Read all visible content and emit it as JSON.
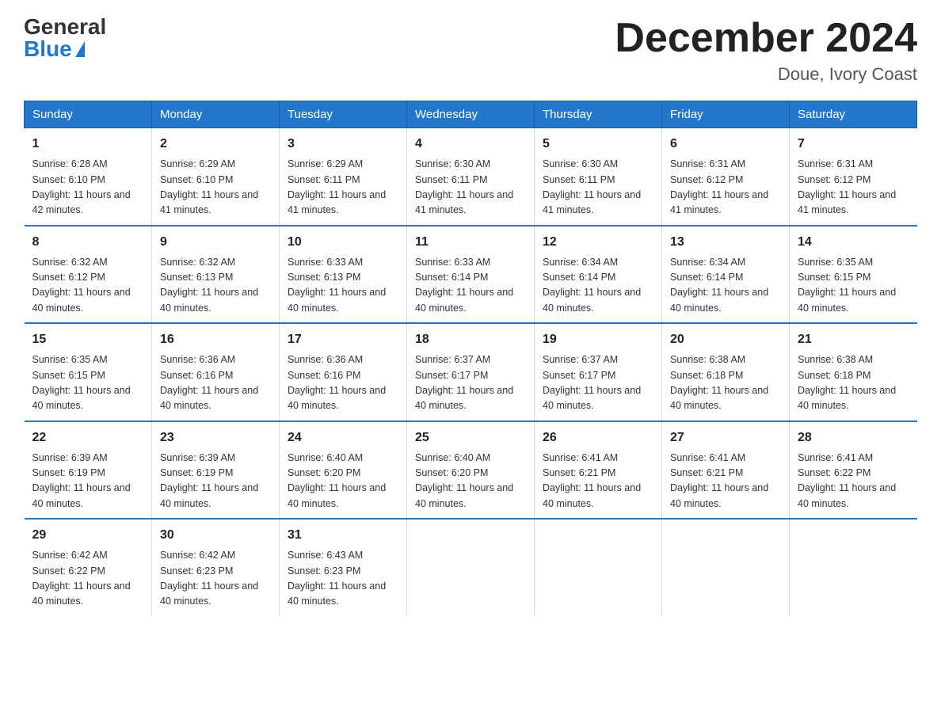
{
  "logo": {
    "general": "General",
    "blue": "Blue"
  },
  "header": {
    "title": "December 2024",
    "subtitle": "Doue, Ivory Coast"
  },
  "columns": [
    "Sunday",
    "Monday",
    "Tuesday",
    "Wednesday",
    "Thursday",
    "Friday",
    "Saturday"
  ],
  "weeks": [
    [
      {
        "day": "1",
        "sunrise": "6:28 AM",
        "sunset": "6:10 PM",
        "daylight": "11 hours and 42 minutes."
      },
      {
        "day": "2",
        "sunrise": "6:29 AM",
        "sunset": "6:10 PM",
        "daylight": "11 hours and 41 minutes."
      },
      {
        "day": "3",
        "sunrise": "6:29 AM",
        "sunset": "6:11 PM",
        "daylight": "11 hours and 41 minutes."
      },
      {
        "day": "4",
        "sunrise": "6:30 AM",
        "sunset": "6:11 PM",
        "daylight": "11 hours and 41 minutes."
      },
      {
        "day": "5",
        "sunrise": "6:30 AM",
        "sunset": "6:11 PM",
        "daylight": "11 hours and 41 minutes."
      },
      {
        "day": "6",
        "sunrise": "6:31 AM",
        "sunset": "6:12 PM",
        "daylight": "11 hours and 41 minutes."
      },
      {
        "day": "7",
        "sunrise": "6:31 AM",
        "sunset": "6:12 PM",
        "daylight": "11 hours and 41 minutes."
      }
    ],
    [
      {
        "day": "8",
        "sunrise": "6:32 AM",
        "sunset": "6:12 PM",
        "daylight": "11 hours and 40 minutes."
      },
      {
        "day": "9",
        "sunrise": "6:32 AM",
        "sunset": "6:13 PM",
        "daylight": "11 hours and 40 minutes."
      },
      {
        "day": "10",
        "sunrise": "6:33 AM",
        "sunset": "6:13 PM",
        "daylight": "11 hours and 40 minutes."
      },
      {
        "day": "11",
        "sunrise": "6:33 AM",
        "sunset": "6:14 PM",
        "daylight": "11 hours and 40 minutes."
      },
      {
        "day": "12",
        "sunrise": "6:34 AM",
        "sunset": "6:14 PM",
        "daylight": "11 hours and 40 minutes."
      },
      {
        "day": "13",
        "sunrise": "6:34 AM",
        "sunset": "6:14 PM",
        "daylight": "11 hours and 40 minutes."
      },
      {
        "day": "14",
        "sunrise": "6:35 AM",
        "sunset": "6:15 PM",
        "daylight": "11 hours and 40 minutes."
      }
    ],
    [
      {
        "day": "15",
        "sunrise": "6:35 AM",
        "sunset": "6:15 PM",
        "daylight": "11 hours and 40 minutes."
      },
      {
        "day": "16",
        "sunrise": "6:36 AM",
        "sunset": "6:16 PM",
        "daylight": "11 hours and 40 minutes."
      },
      {
        "day": "17",
        "sunrise": "6:36 AM",
        "sunset": "6:16 PM",
        "daylight": "11 hours and 40 minutes."
      },
      {
        "day": "18",
        "sunrise": "6:37 AM",
        "sunset": "6:17 PM",
        "daylight": "11 hours and 40 minutes."
      },
      {
        "day": "19",
        "sunrise": "6:37 AM",
        "sunset": "6:17 PM",
        "daylight": "11 hours and 40 minutes."
      },
      {
        "day": "20",
        "sunrise": "6:38 AM",
        "sunset": "6:18 PM",
        "daylight": "11 hours and 40 minutes."
      },
      {
        "day": "21",
        "sunrise": "6:38 AM",
        "sunset": "6:18 PM",
        "daylight": "11 hours and 40 minutes."
      }
    ],
    [
      {
        "day": "22",
        "sunrise": "6:39 AM",
        "sunset": "6:19 PM",
        "daylight": "11 hours and 40 minutes."
      },
      {
        "day": "23",
        "sunrise": "6:39 AM",
        "sunset": "6:19 PM",
        "daylight": "11 hours and 40 minutes."
      },
      {
        "day": "24",
        "sunrise": "6:40 AM",
        "sunset": "6:20 PM",
        "daylight": "11 hours and 40 minutes."
      },
      {
        "day": "25",
        "sunrise": "6:40 AM",
        "sunset": "6:20 PM",
        "daylight": "11 hours and 40 minutes."
      },
      {
        "day": "26",
        "sunrise": "6:41 AM",
        "sunset": "6:21 PM",
        "daylight": "11 hours and 40 minutes."
      },
      {
        "day": "27",
        "sunrise": "6:41 AM",
        "sunset": "6:21 PM",
        "daylight": "11 hours and 40 minutes."
      },
      {
        "day": "28",
        "sunrise": "6:41 AM",
        "sunset": "6:22 PM",
        "daylight": "11 hours and 40 minutes."
      }
    ],
    [
      {
        "day": "29",
        "sunrise": "6:42 AM",
        "sunset": "6:22 PM",
        "daylight": "11 hours and 40 minutes."
      },
      {
        "day": "30",
        "sunrise": "6:42 AM",
        "sunset": "6:23 PM",
        "daylight": "11 hours and 40 minutes."
      },
      {
        "day": "31",
        "sunrise": "6:43 AM",
        "sunset": "6:23 PM",
        "daylight": "11 hours and 40 minutes."
      },
      {
        "day": "",
        "sunrise": "",
        "sunset": "",
        "daylight": ""
      },
      {
        "day": "",
        "sunrise": "",
        "sunset": "",
        "daylight": ""
      },
      {
        "day": "",
        "sunrise": "",
        "sunset": "",
        "daylight": ""
      },
      {
        "day": "",
        "sunrise": "",
        "sunset": "",
        "daylight": ""
      }
    ]
  ]
}
